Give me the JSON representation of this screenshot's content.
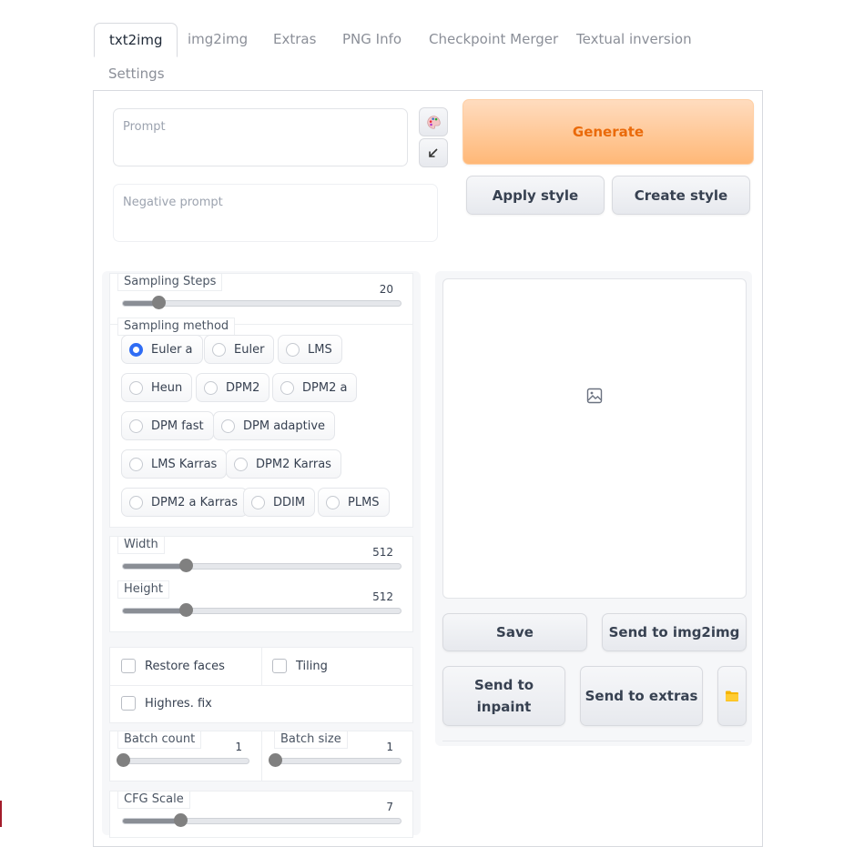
{
  "tabs": [
    "txt2img",
    "img2img",
    "Extras",
    "PNG Info",
    "Checkpoint Merger",
    "Textual inversion",
    "Settings"
  ],
  "active_tab": "txt2img",
  "prompt": {
    "placeholder": "Prompt",
    "value": ""
  },
  "negative_prompt": {
    "placeholder": "Negative prompt",
    "value": ""
  },
  "tool_icons": [
    "palette-icon",
    "arrow-down-left-icon"
  ],
  "buttons": {
    "generate": "Generate",
    "apply_style": "Apply style",
    "create_style": "Create style",
    "save": "Save",
    "send_img2img": "Send to img2img",
    "send_inpaint": "Send to\ninpaint",
    "send_extras": "Send to extras",
    "folder_icon": "folder-icon"
  },
  "sampling_steps": {
    "label": "Sampling Steps",
    "value": "20",
    "min": 1,
    "max": 150,
    "level": 20
  },
  "sampling_method": {
    "label": "Sampling method",
    "options": [
      "Euler a",
      "Euler",
      "LMS",
      "Heun",
      "DPM2",
      "DPM2 a",
      "DPM fast",
      "DPM adaptive",
      "LMS Karras",
      "DPM2 Karras",
      "DPM2 a Karras",
      "DDIM",
      "PLMS"
    ],
    "selected": "Euler a"
  },
  "width": {
    "label": "Width",
    "value": "512",
    "min": 64,
    "max": 2048,
    "level": 512
  },
  "height": {
    "label": "Height",
    "value": "512",
    "min": 64,
    "max": 2048,
    "level": 512
  },
  "checkboxes": {
    "restore_faces": "Restore faces",
    "tiling": "Tiling",
    "highres_fix": "Highres. fix"
  },
  "batch_count": {
    "label": "Batch count",
    "value": "1",
    "min": 1,
    "max": 100,
    "level": 1
  },
  "batch_size": {
    "label": "Batch size",
    "value": "1",
    "min": 1,
    "max": 8,
    "level": 1
  },
  "cfg_scale": {
    "label": "CFG Scale",
    "value": "7",
    "min": 1,
    "max": 30,
    "level": 7
  },
  "colors": {
    "accent": "#2f6cf4",
    "generate_text": "#ea6a0a",
    "generate_bg": "#ffb877"
  },
  "image_placeholder_icon": "image-icon"
}
